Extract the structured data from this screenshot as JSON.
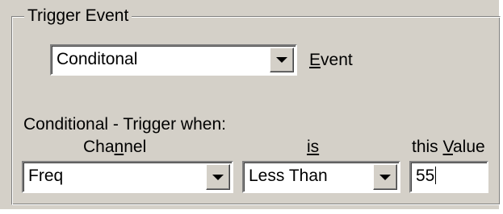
{
  "group": {
    "title": "Trigger Event"
  },
  "event": {
    "selected": "Conditonal",
    "label": "Event"
  },
  "conditional": {
    "heading": "Conditional - Trigger when:",
    "channel_label": "Channel",
    "is_label": "is",
    "value_label": "this Value",
    "channel_selected": "Freq",
    "comparison_selected": "Less Than",
    "value": "55"
  },
  "icons": {
    "dropdown": "chevron-down-icon"
  }
}
